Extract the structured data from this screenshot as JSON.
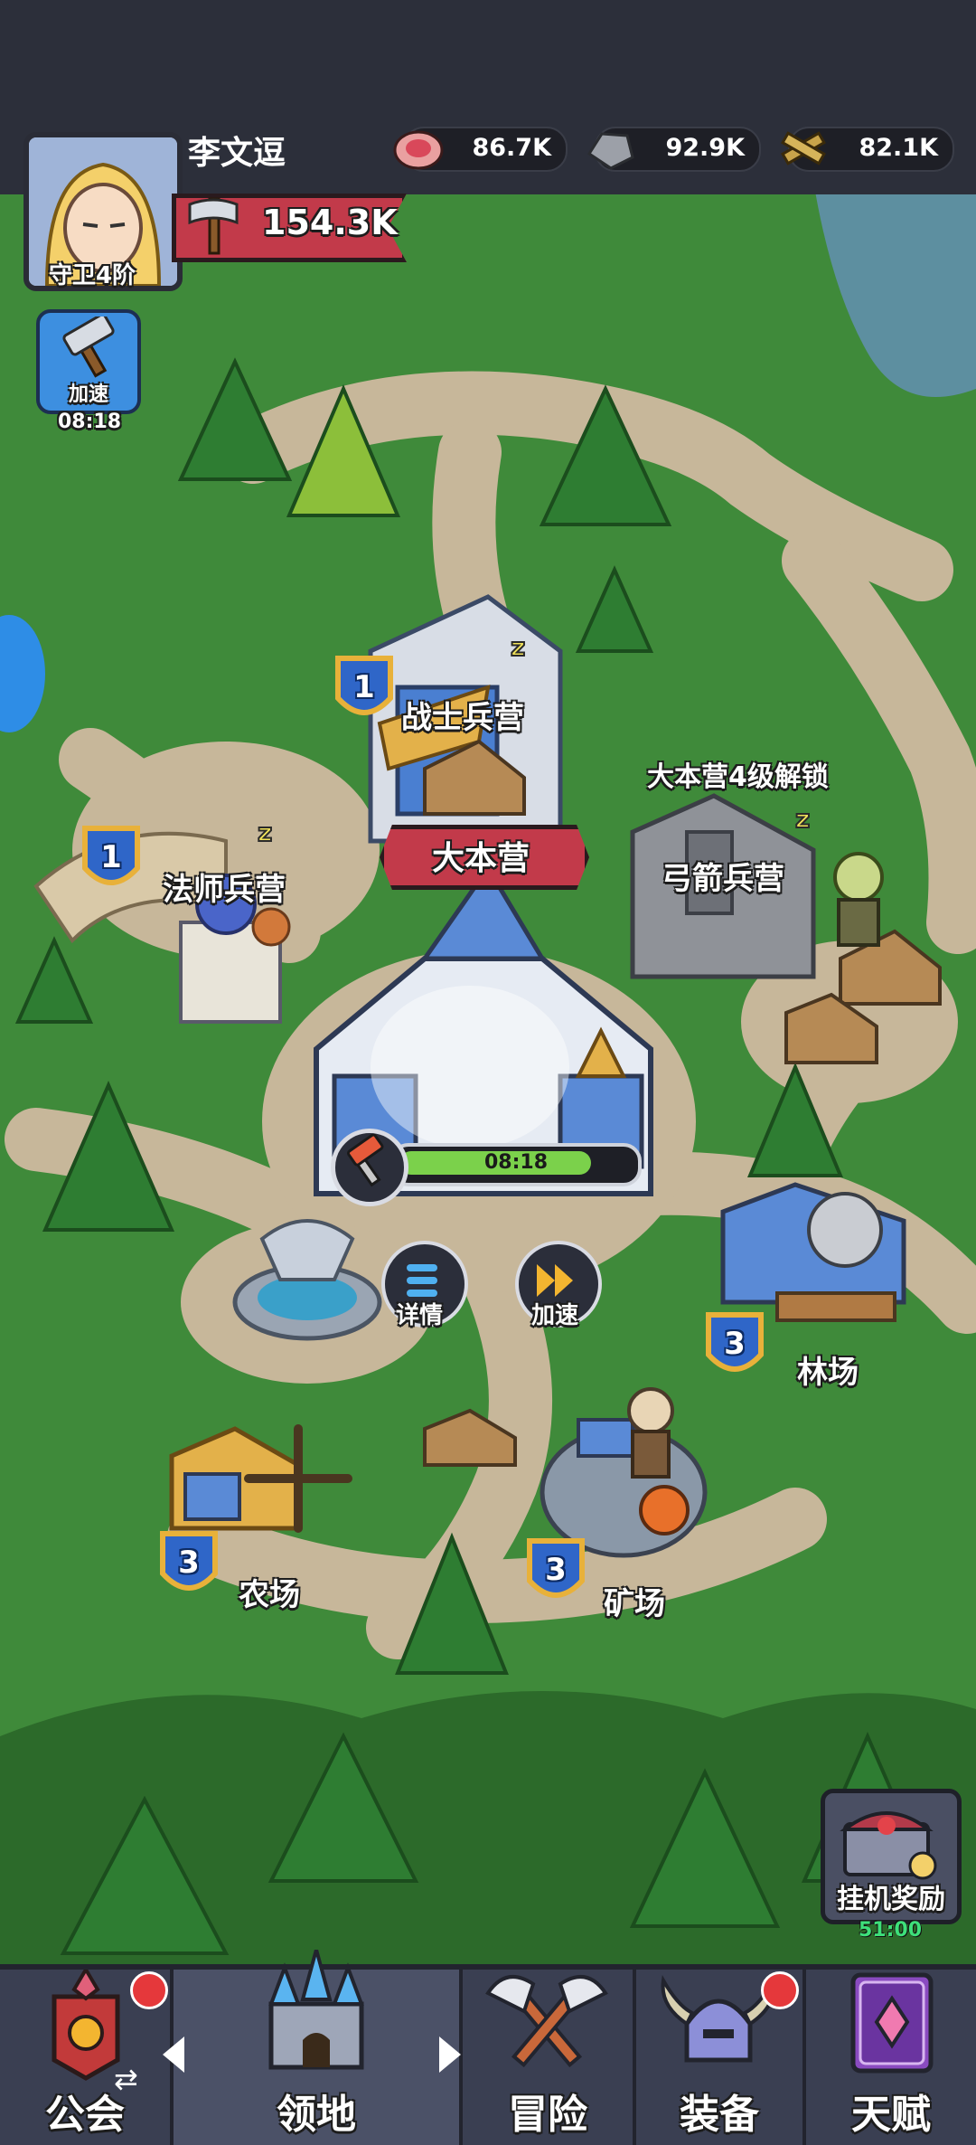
{
  "player": {
    "name": "李文逗",
    "rank": "守卫4阶",
    "power": "154.3K"
  },
  "resources": [
    {
      "icon": "meat-icon",
      "value": "86.7K"
    },
    {
      "icon": "stone-icon",
      "value": "92.9K"
    },
    {
      "icon": "wood-icon",
      "value": "82.1K"
    }
  ],
  "boost_side": {
    "label": "加速",
    "timer": "08:18"
  },
  "buildings": {
    "warrior": {
      "name": "战士兵营",
      "level": "1"
    },
    "mage": {
      "name": "法师兵营",
      "level": "1"
    },
    "archer": {
      "name": "弓箭兵营",
      "lock_text": "大本营4级解锁"
    },
    "hq": {
      "name": "大本营",
      "timer": "08:18",
      "progress": 0.82
    },
    "lumber": {
      "name": "林场",
      "level": "3"
    },
    "farm": {
      "name": "农场",
      "level": "3"
    },
    "mine": {
      "name": "矿场",
      "level": "3"
    }
  },
  "hq_actions": {
    "details": "详情",
    "speedup": "加速"
  },
  "idle_reward": {
    "label": "挂机奖励",
    "timer": "51:00"
  },
  "nav": [
    {
      "label": "公会",
      "icon": "guild-banner-icon",
      "badge": true
    },
    {
      "label": "领地",
      "icon": "castle-icon",
      "badge": false
    },
    {
      "label": "冒险",
      "icon": "crossed-axes-icon",
      "badge": false
    },
    {
      "label": "装备",
      "icon": "helmet-icon",
      "badge": true
    },
    {
      "label": "天赋",
      "icon": "talent-book-icon",
      "badge": false
    }
  ],
  "colors": {
    "grass": "#3f8a3a",
    "path": "#c7b79a",
    "topbar": "#2c2f3a",
    "nav": "#3a3f52",
    "banner_red": "#c23a4a",
    "progress_green": "#7bd14b",
    "timer_green": "#3ee07a"
  }
}
